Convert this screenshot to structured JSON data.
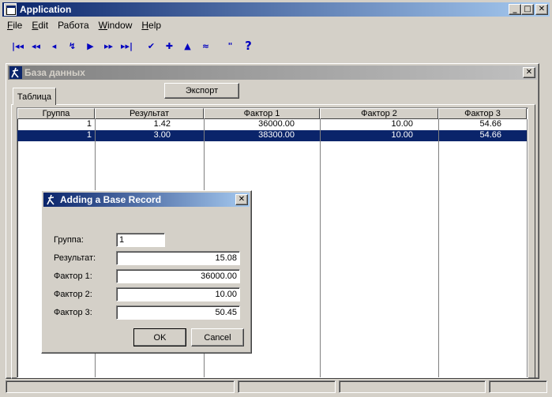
{
  "app": {
    "title": "Application",
    "minimize": "_",
    "maximize": "□",
    "close": "✕"
  },
  "menu": [
    {
      "label": "File",
      "ul": "F",
      "rest": "ile"
    },
    {
      "label": "Edit",
      "ul": "E",
      "rest": "dit"
    },
    {
      "label": "Работа",
      "ul": "",
      "rest": "Работа"
    },
    {
      "label": "Window",
      "ul": "W",
      "rest": "indow"
    },
    {
      "label": "Help",
      "ul": "H",
      "rest": "elp"
    }
  ],
  "toolbar": {
    "first": "|◂◂",
    "prev_page": "◂◂",
    "prev": "◂",
    "refresh": "↯",
    "next": "▶",
    "next_page": "▸▸",
    "last": "▸▸|",
    "check": "✔",
    "add": "✚",
    "edit": "▲",
    "cancel": "≈",
    "quote": "\"",
    "help": "?"
  },
  "mdi": {
    "title": "База данных",
    "close": "✕",
    "export_label": "Экспорт",
    "tab_label": "Таблица"
  },
  "grid": {
    "columns": [
      "Группа",
      "Результат",
      "Фактор 1",
      "Фактор 2",
      "Фактор 3"
    ],
    "rows": [
      {
        "cells": [
          "1",
          "1.42",
          "36000.00",
          "10.00",
          "54.66"
        ],
        "selected": false
      },
      {
        "cells": [
          "1",
          "3.00",
          "38300.00",
          "10.00",
          "54.66"
        ],
        "selected": true
      }
    ]
  },
  "dialog": {
    "title": "Adding a Base Record",
    "close": "✕",
    "fields": [
      {
        "label": "Группа:",
        "value": "1"
      },
      {
        "label": "Результат:",
        "value": "15.08"
      },
      {
        "label": "Фактор 1:",
        "value": "36000.00"
      },
      {
        "label": "Фактор 2:",
        "value": "10.00"
      },
      {
        "label": "Фактор 3:",
        "value": "50.45"
      }
    ],
    "ok_label": "OK",
    "cancel_label": "Cancel"
  }
}
